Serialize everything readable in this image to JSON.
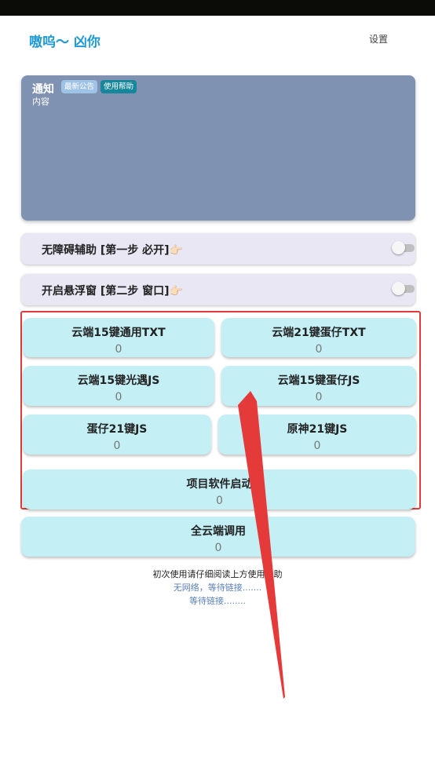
{
  "header": {
    "app_title": "嗷呜～ 凶你",
    "settings_label": "设置"
  },
  "notice": {
    "title": "通知",
    "tag_latest": "最新公告",
    "tag_help": "使用帮助",
    "content": "内容"
  },
  "toggles": [
    {
      "label": "无障碍辅助 [第一步 必开]👉🏻",
      "enabled": false
    },
    {
      "label": "开启悬浮窗 [第二步 窗口]👉🏻",
      "enabled": false
    }
  ],
  "buttons": [
    {
      "name": "云端15键通用TXT",
      "count": "0"
    },
    {
      "name": "云端21键蛋仔TXT",
      "count": "0"
    },
    {
      "name": "云端15键光遇JS",
      "count": "0"
    },
    {
      "name": "云端15键蛋仔JS",
      "count": "0"
    },
    {
      "name": "蛋仔21键JS",
      "count": "0"
    },
    {
      "name": "原神21键JS",
      "count": "0"
    },
    {
      "name": "项目软件启动",
      "count": "0"
    },
    {
      "name": "全云端调用",
      "count": "0"
    }
  ],
  "footer": {
    "line1": "初次使用请仔细阅读上方使用帮助",
    "line2": "无网络，等待链接.......",
    "line3": "等待链接........"
  },
  "colors": {
    "accent": "#1e9ad6",
    "notice_bg": "#8092b2",
    "button_bg": "#c3eff5",
    "annotation_red": "#e53a3a"
  }
}
